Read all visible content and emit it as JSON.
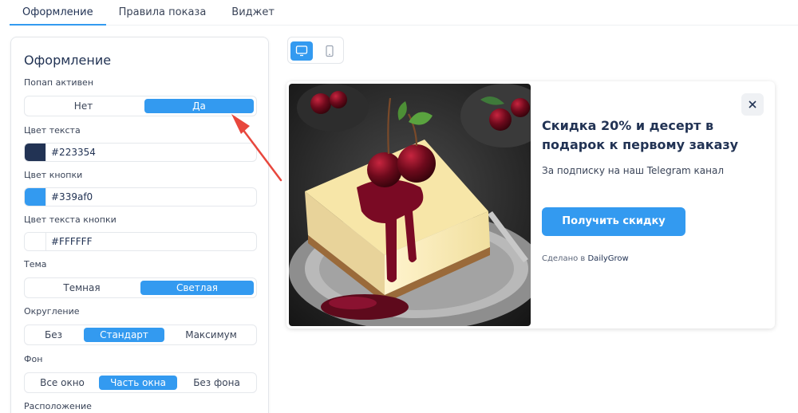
{
  "tabs": [
    {
      "label": "Оформление",
      "active": true
    },
    {
      "label": "Правила показа",
      "active": false
    },
    {
      "label": "Виджет",
      "active": false
    }
  ],
  "panel": {
    "title": "Оформление",
    "popup_active": {
      "label": "Попап активен",
      "options": [
        "Нет",
        "Да"
      ],
      "selected": "Да"
    },
    "text_color": {
      "label": "Цвет текста",
      "value": "#223354"
    },
    "button_color": {
      "label": "Цвет кнопки",
      "value": "#339af0"
    },
    "button_text_color": {
      "label": "Цвет текста кнопки",
      "value": "#FFFFFF"
    },
    "theme": {
      "label": "Тема",
      "options": [
        "Темная",
        "Светлая"
      ],
      "selected": "Светлая"
    },
    "rounding": {
      "label": "Округление",
      "options": [
        "Без",
        "Стандарт",
        "Максимум"
      ],
      "selected": "Стандарт"
    },
    "background": {
      "label": "Фон",
      "options": [
        "Все окно",
        "Часть окна",
        "Без фона"
      ],
      "selected": "Часть окна"
    },
    "position": {
      "label": "Расположение"
    }
  },
  "device_toggle": {
    "selected": "desktop",
    "icons": [
      "desktop-icon",
      "mobile-icon"
    ]
  },
  "popup": {
    "title": "Скидка 20% и десерт в подарок к первому заказу",
    "subtitle": "За подписку на наш Telegram канал",
    "button_label": "Получить скидку",
    "made_by_prefix": "Сделано в",
    "made_by_brand": "DailyGrow",
    "image": "cheesecake-with-cherries"
  },
  "colors": {
    "accent": "#339af0",
    "text": "#223354",
    "arrow": "#e8473d"
  }
}
